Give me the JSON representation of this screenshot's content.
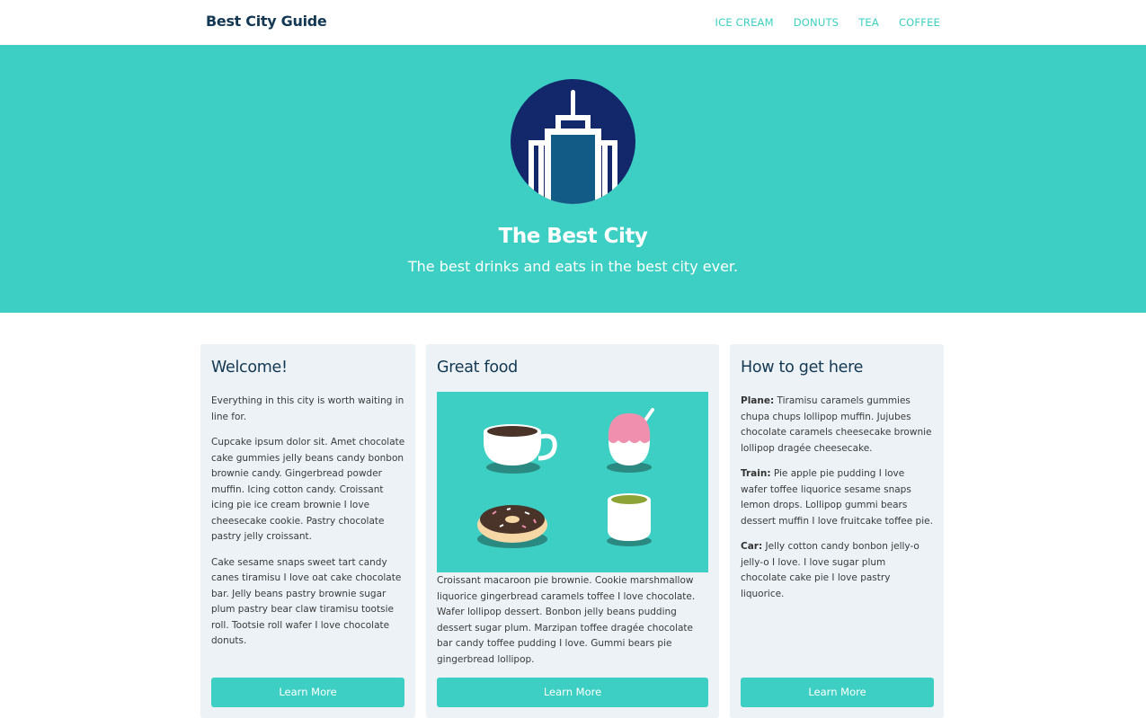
{
  "header": {
    "brand": "Best City Guide",
    "nav": [
      "ICE CREAM",
      "DONUTS",
      "TEA",
      "COFFEE"
    ]
  },
  "hero": {
    "icon": "city-skyscraper-icon",
    "title": "The Best City",
    "subtitle": "The best drinks and eats in the best city ever."
  },
  "cards": [
    {
      "title": "Welcome!",
      "paragraphs": [
        "Everything in this city is worth waiting in line for.",
        "Cupcake ipsum dolor sit. Amet chocolate cake gummies jelly beans candy bonbon brownie candy. Gingerbread powder muffin. Icing cotton candy. Croissant icing pie ice cream brownie I love cheesecake cookie. Pastry chocolate pastry jelly croissant.",
        "Cake sesame snaps sweet tart candy canes tiramisu I love oat cake chocolate bar. Jelly beans pastry brownie sugar plum pastry bear claw tiramisu tootsie roll. Tootsie roll wafer I love chocolate donuts."
      ],
      "button": "Learn More"
    },
    {
      "title": "Great food",
      "image": "food-illustration-coffee-icecream-donut-tea",
      "paragraph": "Croissant macaroon pie brownie. Cookie marshmallow liquorice gingerbread caramels toffee I love chocolate. Wafer lollipop dessert. Bonbon jelly beans pudding dessert sugar plum. Marzipan toffee dragée chocolate bar candy toffee pudding I love. Gummi bears pie gingerbread lollipop.",
      "button": "Learn More"
    },
    {
      "title": "How to get here",
      "items": [
        {
          "label": "Plane:",
          "text": " Tiramisu caramels gummies chupa chups lollipop muffin. Jujubes chocolate caramels cheesecake brownie lollipop dragée cheesecake."
        },
        {
          "label": "Train:",
          "text": " Pie apple pie pudding I love wafer toffee liquorice sesame snaps lemon drops. Lollipop gummi bears dessert muffin I love fruitcake toffee pie."
        },
        {
          "label": "Car:",
          "text": " Jelly cotton candy bonbon jelly-o jelly-o I love. I love sugar plum chocolate cake pie I love pastry liquorice."
        }
      ],
      "button": "Learn More"
    }
  ],
  "colors": {
    "teal": "#3dcfc3",
    "navy": "#143853",
    "card_bg": "#ecf2f6",
    "logo_circle": "#12286b",
    "building": "#125b86"
  }
}
